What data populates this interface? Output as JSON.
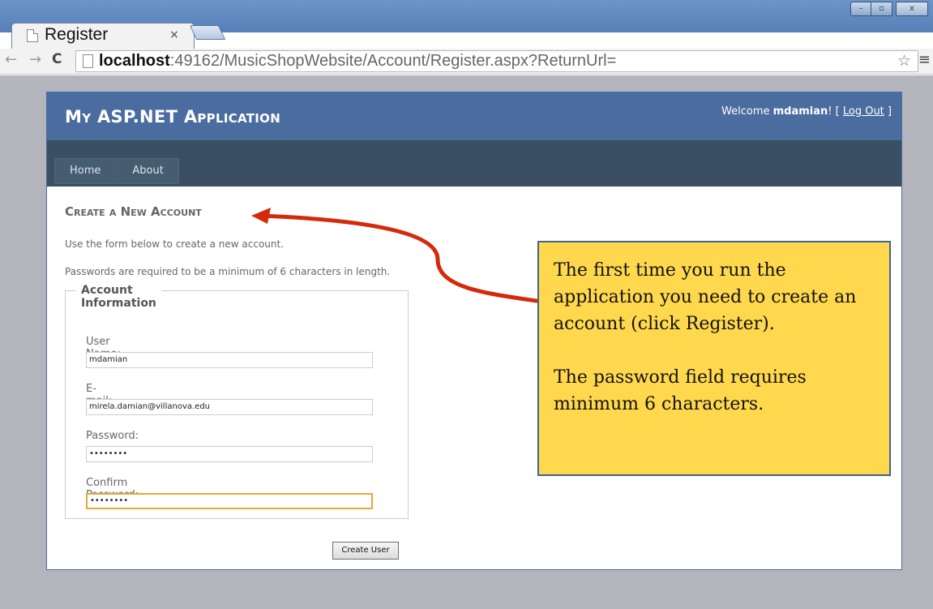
{
  "browser": {
    "tab_title": "Register",
    "tab_close": "×",
    "url_host": "localhost",
    "url_rest": ":49162/MusicShopWebsite/Account/Register.aspx?ReturnUrl=",
    "back_icon": "←",
    "forward_icon": "→",
    "reload_icon": "C",
    "star_icon": "☆",
    "menu_icon": "≡",
    "window_min": "–",
    "window_max": "▫",
    "window_close": "x"
  },
  "site": {
    "title": "My ASP.NET Application",
    "welcome_prefix": "Welcome ",
    "user": "mdamian",
    "welcome_suffix": "! [ ",
    "logout_label": "Log Out",
    "logout_close": " ]",
    "menu": [
      "Home",
      "About"
    ]
  },
  "register": {
    "heading": "Create a New Account",
    "intro": "Use the form below to create a new account.",
    "password_rule": "Passwords are required to be a minimum of 6 characters in length.",
    "legend": "Account Information",
    "username_label": "User Name:",
    "username_value": "mdamian",
    "email_label": "E-mail:",
    "email_value": "mirela.damian@villanova.edu",
    "password_label": "Password:",
    "password_value": "••••••••",
    "confirm_label": "Confirm Password:",
    "confirm_value": "••••••••",
    "submit_label": "Create User"
  },
  "callout": {
    "paragraph1": "The first time you run the application you need to create an account (click Register).",
    "paragraph2": "The password field requires minimum 6 characters.",
    "color_fill": "#ffd84d",
    "color_border": "#44648b",
    "arrow_color": "#d42a0c"
  }
}
